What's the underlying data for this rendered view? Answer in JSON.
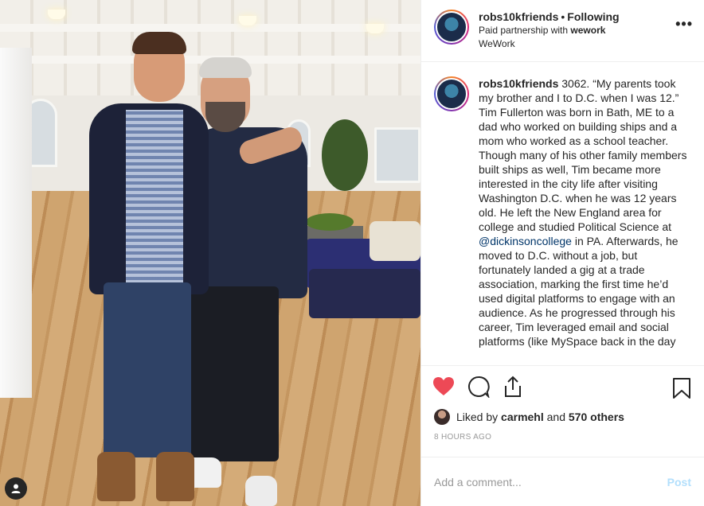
{
  "header": {
    "username": "robs10kfriends",
    "separator": "•",
    "follow_state": "Following",
    "partnership_prefix": "Paid partnership with ",
    "partner": "wework",
    "location": "WeWork",
    "more_label": "•••"
  },
  "caption": {
    "username": "robs10kfriends",
    "text_before_mention": "3062. “My parents took my brother and I to D.C. when I was 12.” Tim Fullerton was born in Bath, ME to a dad who worked on building ships and a mom who worked as a school teacher. Though many of his other family members built ships as well, Tim became more interested in the city life after visiting Washington D.C. when he was 12 years old. He left the New England area for college and studied Political Science at ",
    "mention": "@dickinsoncollege",
    "text_after_mention": " in PA. Afterwards, he moved to D.C. without a job, but fortunately landed a gig at a trade association, marking the first time he’d used digital platforms to engage with an audience. As he progressed through his career, Tim leveraged email and social platforms (like MySpace back in the day"
  },
  "actions": {
    "icons": [
      "heart-icon",
      "comment-icon",
      "share-icon",
      "bookmark-icon"
    ],
    "heart_color": "#ed4956"
  },
  "likes": {
    "prefix": "Liked by ",
    "user": "carmehl",
    "middle": " and ",
    "count": "570 others"
  },
  "timestamp": "8 HOURS AGO",
  "comment": {
    "placeholder": "Add a comment...",
    "post_label": "Post"
  }
}
